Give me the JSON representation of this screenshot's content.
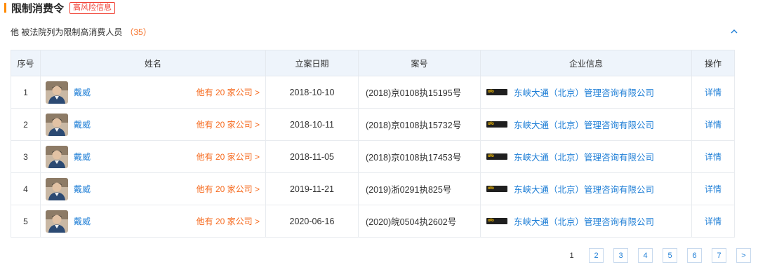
{
  "section": {
    "title": "限制消费令",
    "tag": "高风险信息"
  },
  "summary": {
    "text": "他 被法院列为限制高消费人员",
    "count": "（35）"
  },
  "columns": [
    "序号",
    "姓名",
    "立案日期",
    "案号",
    "企业信息",
    "操作"
  ],
  "rows": [
    {
      "idx": "1",
      "name": "戴威",
      "other": "他有 20 家公司 >",
      "date": "2018-10-10",
      "case": "(2018)京0108执15195号",
      "logo": "ofo",
      "company": "东峡大通（北京）管理咨询有限公司",
      "op": "详情"
    },
    {
      "idx": "2",
      "name": "戴威",
      "other": "他有 20 家公司 >",
      "date": "2018-10-11",
      "case": "(2018)京0108执15732号",
      "logo": "ofo",
      "company": "东峡大通（北京）管理咨询有限公司",
      "op": "详情"
    },
    {
      "idx": "3",
      "name": "戴威",
      "other": "他有 20 家公司 >",
      "date": "2018-11-05",
      "case": "(2018)京0108执17453号",
      "logo": "ofo",
      "company": "东峡大通（北京）管理咨询有限公司",
      "op": "详情"
    },
    {
      "idx": "4",
      "name": "戴威",
      "other": "他有 20 家公司 >",
      "date": "2019-11-21",
      "case": "(2019)浙0291执825号",
      "logo": "ofo",
      "company": "东峡大通（北京）管理咨询有限公司",
      "op": "详情"
    },
    {
      "idx": "5",
      "name": "戴威",
      "other": "他有 20 家公司 >",
      "date": "2020-06-16",
      "case": "(2020)皖0504执2602号",
      "logo": "ofo",
      "company": "东峡大通（北京）管理咨询有限公司",
      "op": "详情"
    }
  ],
  "pagination": {
    "current": "1",
    "pages": [
      "2",
      "3",
      "4",
      "5",
      "6",
      "7"
    ],
    "next": ">"
  },
  "colors": {
    "accent": "#ff8a00",
    "link": "#1e7ed6",
    "highlight": "#f66a1e",
    "header_bg": "#eef4fb"
  },
  "icons": {
    "collapse": "chevron-up-icon",
    "avatar": "person-avatar",
    "company_logo": "ofo-logo"
  }
}
